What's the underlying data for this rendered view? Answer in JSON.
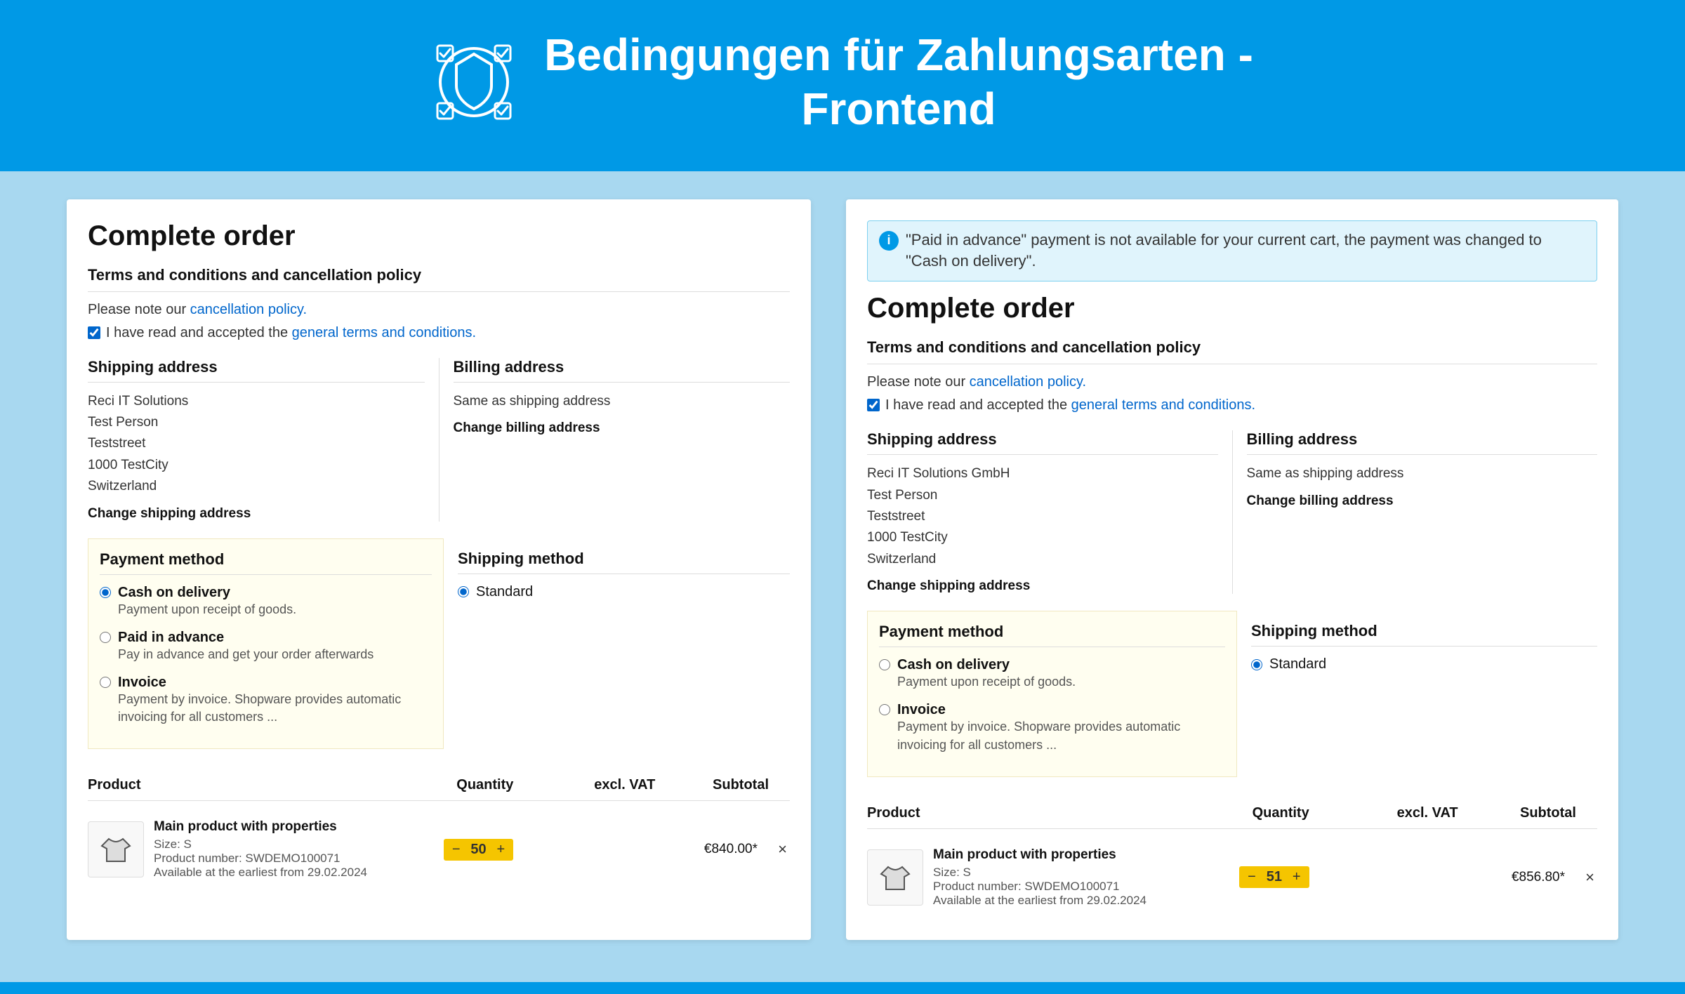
{
  "header": {
    "title_line1": "Bedingungen für Zahlungsarten -",
    "title_line2": "Frontend"
  },
  "left_panel": {
    "title": "Complete order",
    "terms_section_title": "Terms and conditions and cancellation policy",
    "cancellation_text": "Please note our",
    "cancellation_link": "cancellation policy.",
    "checkbox_text_before": "I have read and accepted the",
    "checkbox_link": "general terms and conditions.",
    "shipping_address": {
      "section_title": "Shipping address",
      "line1": "Reci IT Solutions",
      "line2": "Test Person",
      "line3": "Teststreet",
      "line4": "1000 TestCity",
      "line5": "Switzerland",
      "change_link": "Change shipping address"
    },
    "billing_address": {
      "section_title": "Billing address",
      "text": "Same as shipping address",
      "change_link": "Change billing address"
    },
    "payment_method": {
      "section_title": "Payment method",
      "options": [
        {
          "label": "Cash on delivery",
          "desc": "Payment upon receipt of goods.",
          "selected": true
        },
        {
          "label": "Paid in advance",
          "desc": "Pay in advance and get your order afterwards",
          "selected": false
        },
        {
          "label": "Invoice",
          "desc": "Payment by invoice. Shopware provides automatic invoicing for all customers ...",
          "selected": false
        }
      ]
    },
    "shipping_method": {
      "section_title": "Shipping method",
      "options": [
        {
          "label": "Standard",
          "selected": true
        }
      ]
    },
    "product_table": {
      "col_product": "Product",
      "col_quantity": "Quantity",
      "col_vat": "excl. VAT",
      "col_subtotal": "Subtotal",
      "rows": [
        {
          "name": "Main product with properties",
          "size": "Size: S",
          "sku": "Product number: SWDEMO100071",
          "availability": "Available at the earliest from 29.02.2024",
          "quantity": "50",
          "vat": "",
          "subtotal": "€840.00*",
          "remove": "×"
        }
      ]
    }
  },
  "right_panel": {
    "info_banner": "\"Paid in advance\" payment is not available for your current cart, the payment was changed to \"Cash on delivery\".",
    "title": "Complete order",
    "terms_section_title": "Terms and conditions and cancellation policy",
    "cancellation_text": "Please note our",
    "cancellation_link": "cancellation policy.",
    "checkbox_text_before": "I have read and accepted the",
    "checkbox_link": "general terms and conditions.",
    "shipping_address": {
      "section_title": "Shipping address",
      "line1": "Reci IT Solutions GmbH",
      "line2": "Test Person",
      "line3": "Teststreet",
      "line4": "1000 TestCity",
      "line5": "Switzerland",
      "change_link": "Change shipping address"
    },
    "billing_address": {
      "section_title": "Billing address",
      "text": "Same as shipping address",
      "change_link": "Change billing address"
    },
    "payment_method": {
      "section_title": "Payment method",
      "options": [
        {
          "label": "Cash on delivery",
          "desc": "Payment upon receipt of goods.",
          "selected": false
        },
        {
          "label": "Invoice",
          "desc": "Payment by invoice. Shopware provides automatic invoicing for all customers ...",
          "selected": false
        }
      ]
    },
    "shipping_method": {
      "section_title": "Shipping method",
      "options": [
        {
          "label": "Standard",
          "selected": true
        }
      ]
    },
    "product_table": {
      "col_product": "Product",
      "col_quantity": "Quantity",
      "col_vat": "excl. VAT",
      "col_subtotal": "Subtotal",
      "rows": [
        {
          "name": "Main product with properties",
          "size": "Size: S",
          "sku": "Product number: SWDEMO100071",
          "availability": "Available at the earliest from 29.02.2024",
          "quantity": "51",
          "vat": "",
          "subtotal": "€856.80*",
          "remove": "×"
        }
      ]
    }
  }
}
